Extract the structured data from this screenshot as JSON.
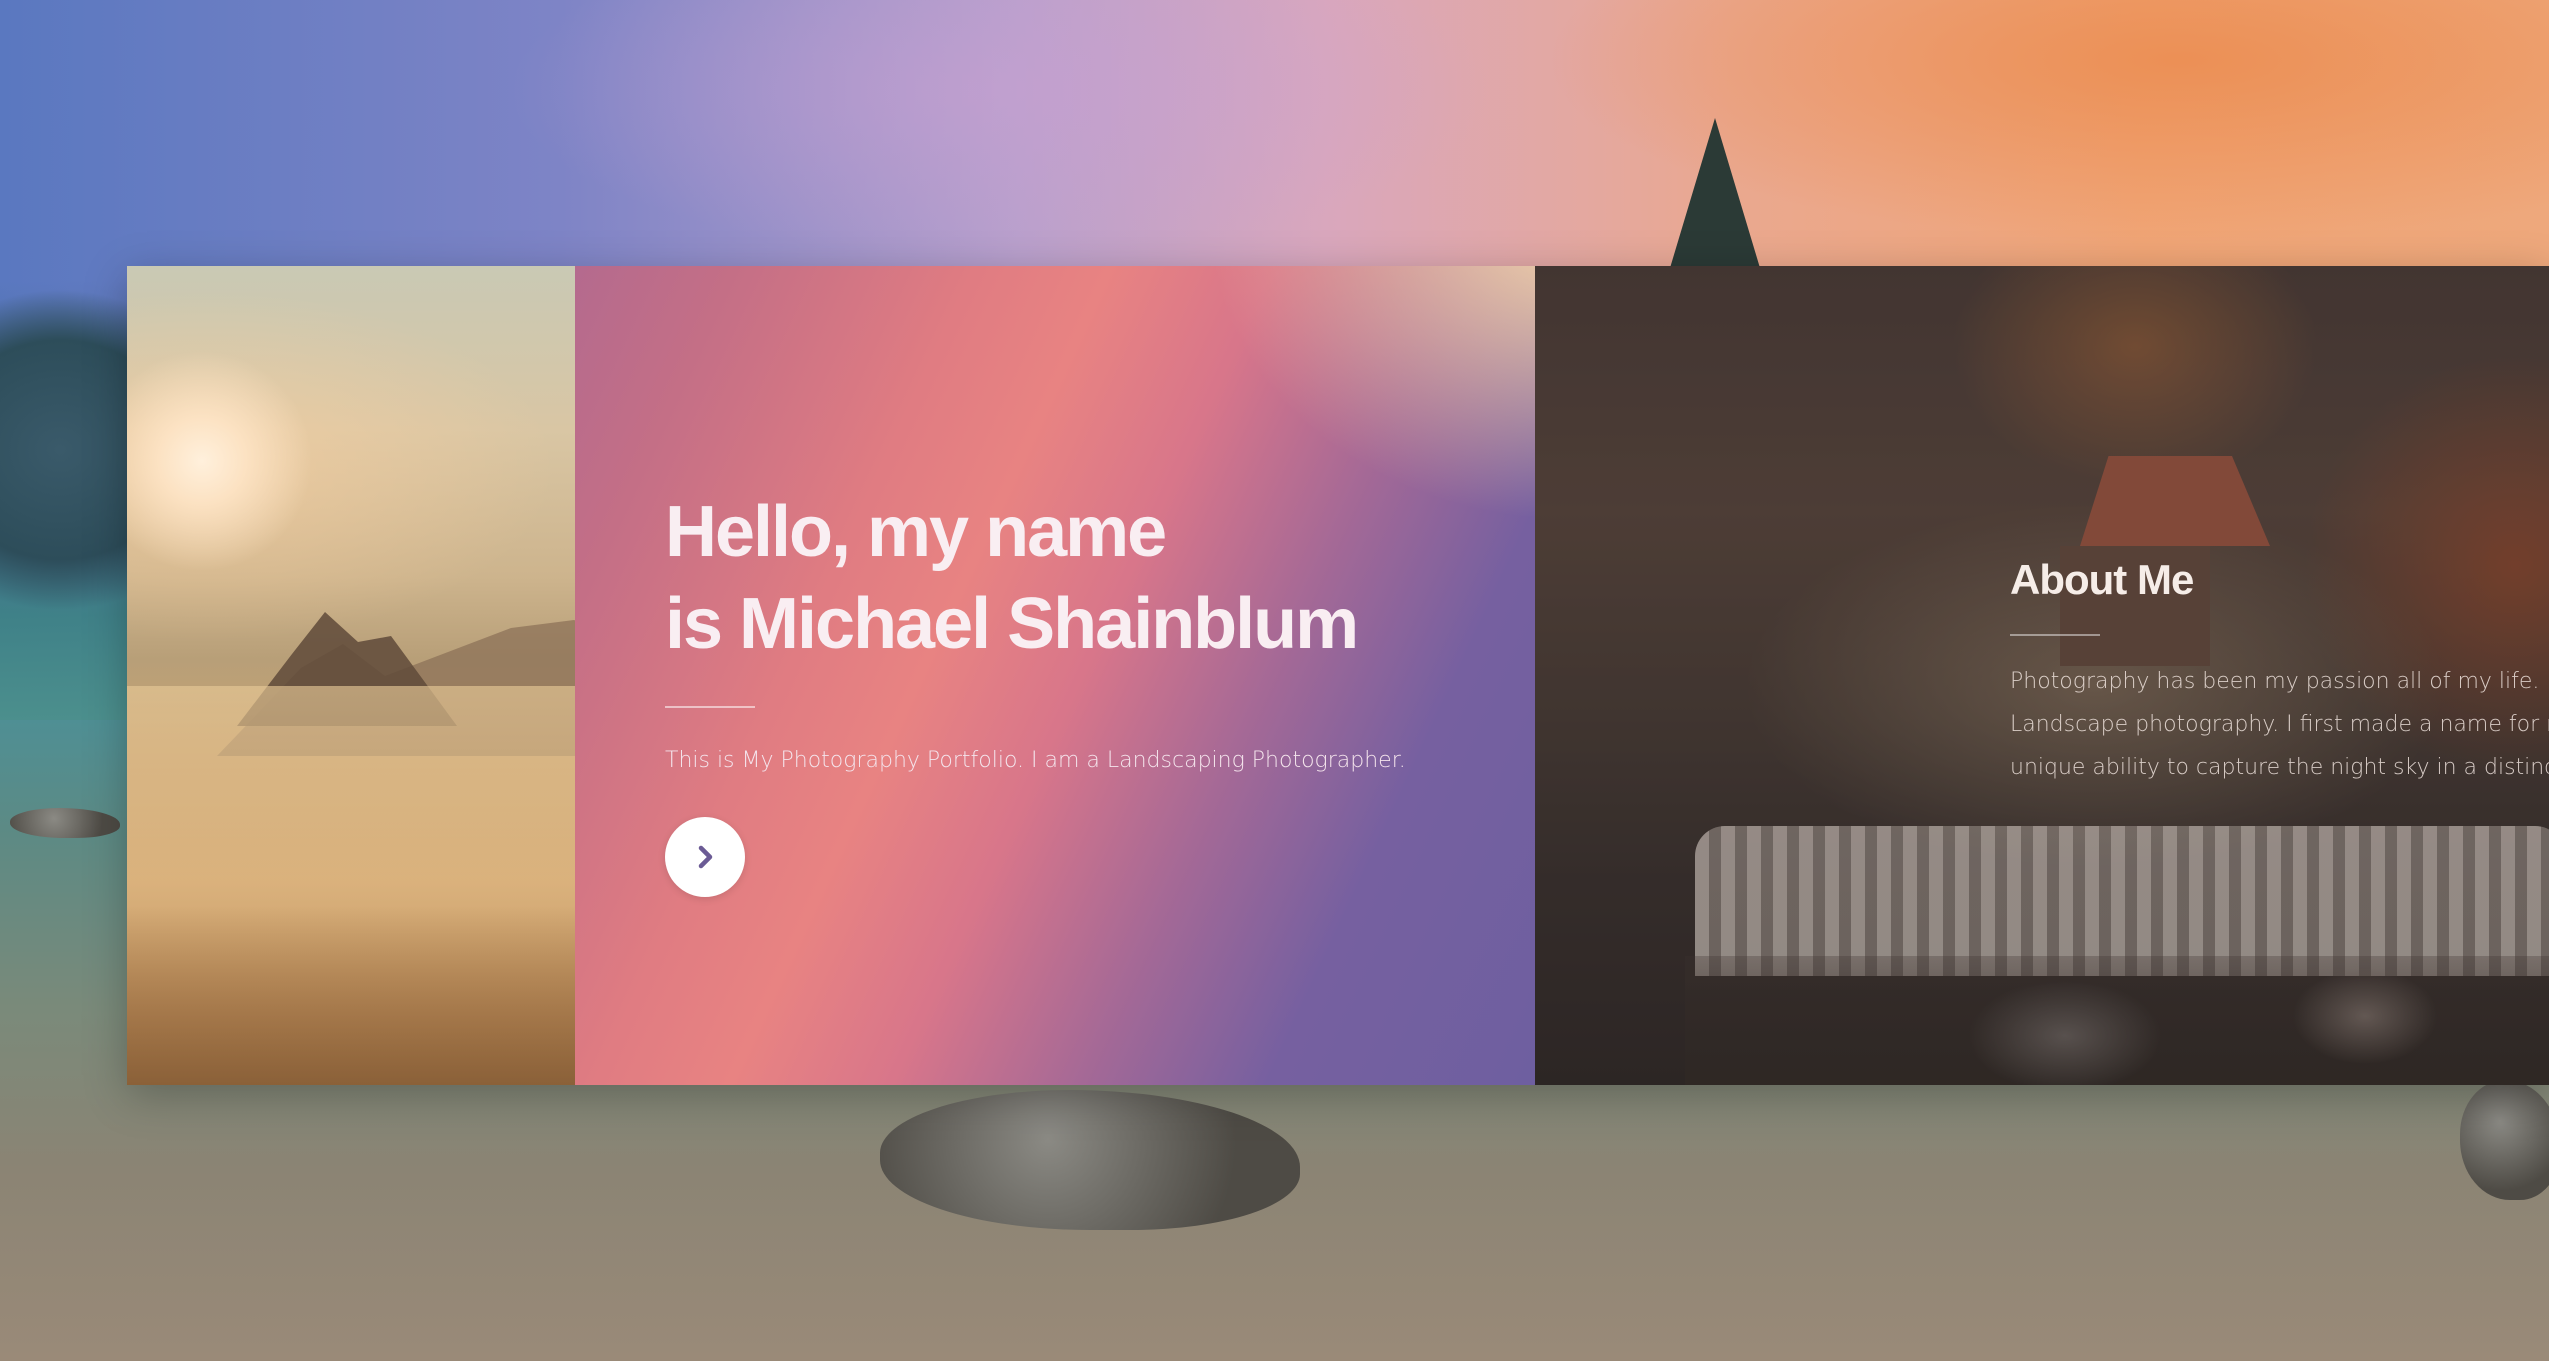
{
  "hero": {
    "title_line1": "Hello, my name",
    "title_line2": "is Michael Shainblum",
    "subtitle": "This is My Photography Portfolio. I am a Landscaping Photographer.",
    "next_icon": "chevron-right-icon"
  },
  "about": {
    "title": "About Me",
    "lines": [
      "Photography has been my passion all of my life. I spe",
      "Landscape photography. I first made a name for mys",
      "unique ability to capture the night sky in a distinct su"
    ]
  },
  "colors": {
    "hero_gradient_start": "#6e5fa0",
    "hero_gradient_mid": "#e88382",
    "hero_gradient_end": "#f6d7a7",
    "button_bg": "#ffffff",
    "icon_color": "#6b5b95"
  }
}
